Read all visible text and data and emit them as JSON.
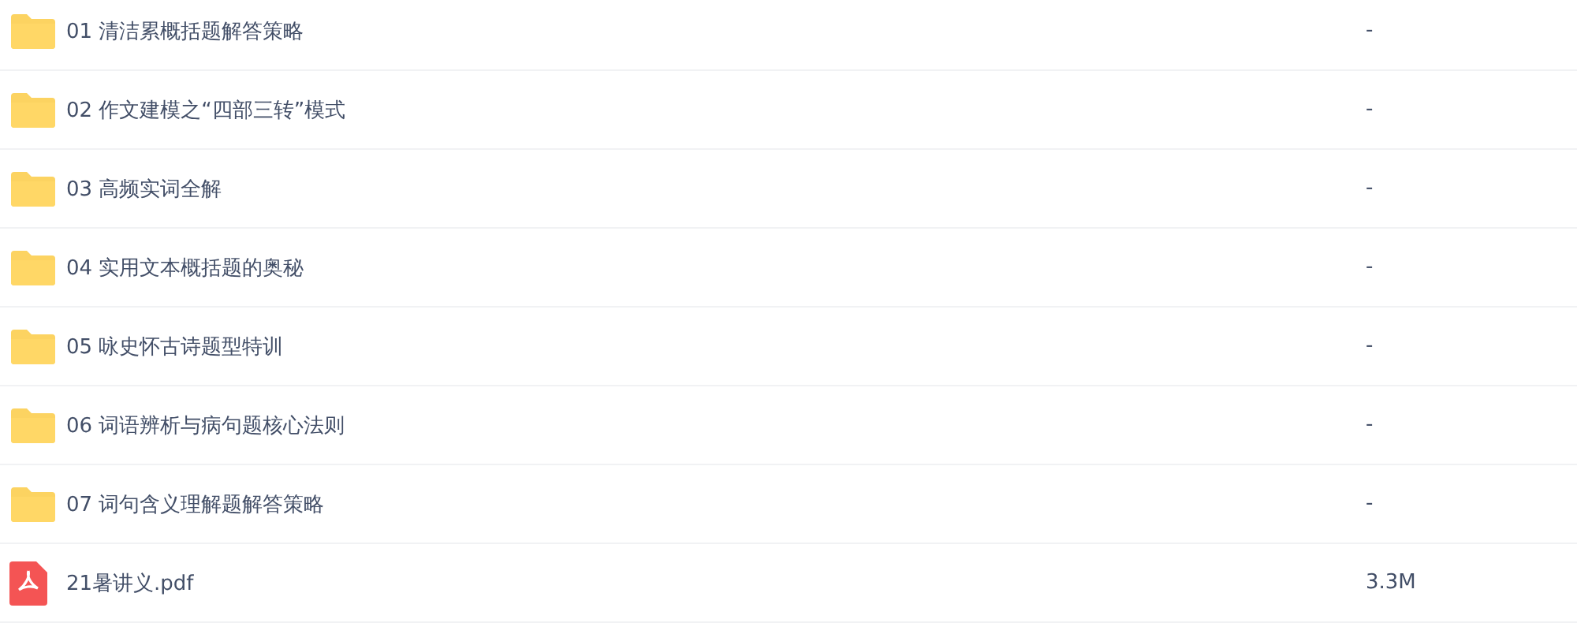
{
  "files": [
    {
      "kind": "folder",
      "name": "01 清洁累概括题解答策略",
      "size": "-"
    },
    {
      "kind": "folder",
      "name": "02 作文建模之“四部三转”模式",
      "size": "-"
    },
    {
      "kind": "folder",
      "name": "03 高频实词全解",
      "size": "-"
    },
    {
      "kind": "folder",
      "name": "04 实用文本概括题的奥秘",
      "size": "-"
    },
    {
      "kind": "folder",
      "name": "05 咏史怀古诗题型特训",
      "size": "-"
    },
    {
      "kind": "folder",
      "name": "06 词语辨析与病句题核心法则",
      "size": "-"
    },
    {
      "kind": "folder",
      "name": "07 词句含义理解题解答策略",
      "size": "-"
    },
    {
      "kind": "pdf",
      "name": "21暑讲义.pdf",
      "size": "3.3M"
    }
  ]
}
